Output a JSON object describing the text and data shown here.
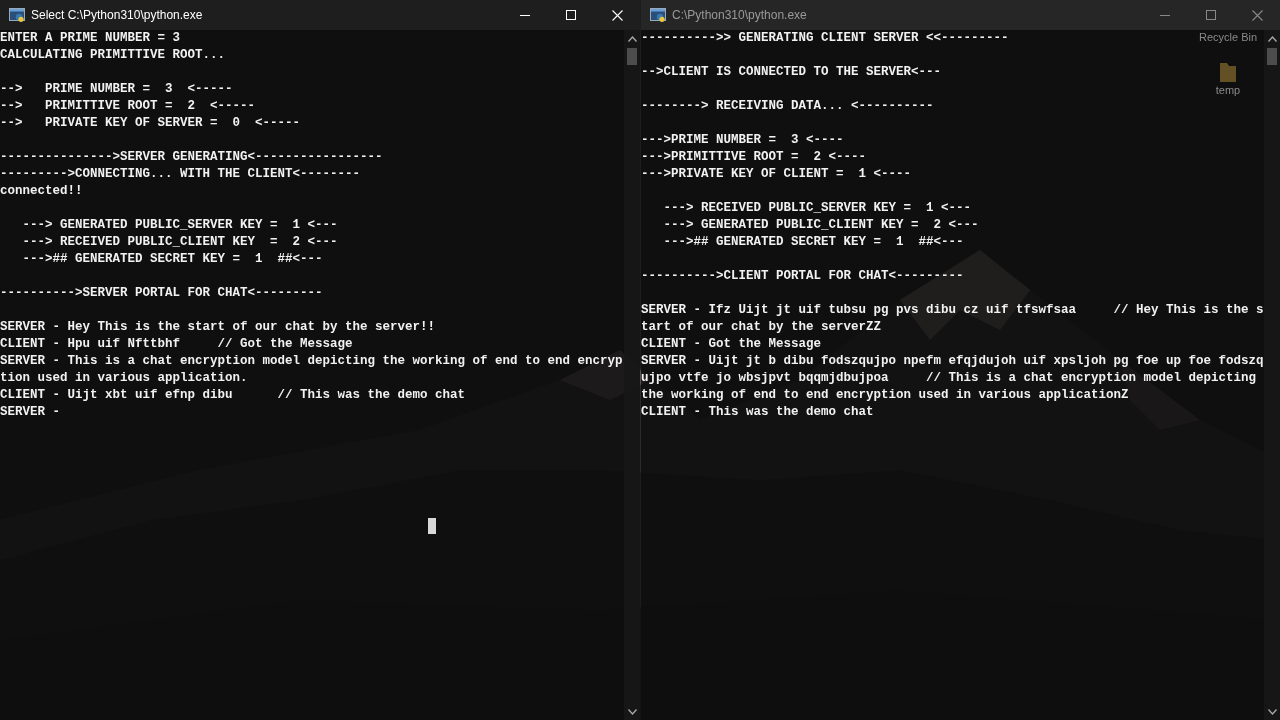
{
  "desktop": {
    "icons": [
      {
        "kind": "bin",
        "label": "Recycle Bin"
      },
      {
        "kind": "folder",
        "label": "temp"
      }
    ]
  },
  "windows": [
    {
      "title": "Select C:\\Python310\\python.exe",
      "active": true,
      "cursor": true,
      "blocks": [
        [
          "ENTER A PRIME NUMBER = 3",
          "CALCULATING PRIMITTIVE ROOT..."
        ],
        [
          "-->   PRIME NUMBER =  3  <-----",
          "-->   PRIMITTIVE ROOT =  2  <-----",
          "-->   PRIVATE KEY OF SERVER =  0  <-----"
        ],
        [
          "--------------->SERVER GENERATING<-----------------",
          "--------->CONNECTING... WITH THE CLIENT<--------",
          "connected!!"
        ],
        [
          "   ---> GENERATED PUBLIC_SERVER KEY =  1 <---",
          "   ---> RECEIVED PUBLIC_CLIENT KEY  =  2 <---",
          "   --->## GENERATED SECRET KEY =  1  ##<---"
        ],
        [
          "---------->SERVER PORTAL FOR CHAT<---------"
        ],
        [
          "SERVER - Hey This is the start of our chat by the server!!",
          "CLIENT - Hpu uif Nfttbhf     // Got the Message",
          "SERVER - This is a chat encryption model depicting the working of end to end encryp",
          "tion used in various application.",
          "CLIENT - Uijt xbt uif efnp dibu      // This was the demo chat",
          "SERVER -"
        ]
      ]
    },
    {
      "title": "C:\\Python310\\python.exe",
      "active": false,
      "blocks": [
        [
          "---------->> GENERATING CLIENT SERVER <<---------"
        ],
        [
          "-->CLIENT IS CONNECTED TO THE SERVER<---"
        ],
        [
          "--------> RECEIVING DATA... <----------"
        ],
        [
          "--->PRIME NUMBER =  3 <----",
          "--->PRIMITTIVE ROOT =  2 <----",
          "--->PRIVATE KEY OF CLIENT =  1 <----"
        ],
        [
          "   ---> RECEIVED PUBLIC_SERVER KEY =  1 <---",
          "   ---> GENERATED PUBLIC_CLIENT KEY =  2 <---",
          "   --->## GENERATED SECRET KEY =  1  ##<---"
        ],
        [
          "---------->CLIENT PORTAL FOR CHAT<---------"
        ],
        [
          "SERVER - Ifz Uijt jt uif tubsu pg pvs dibu cz uif tfswfsaa     // Hey This is the s",
          "tart of our chat by the serverZZ",
          "CLIENT - Got the Message",
          "SERVER - Uijt jt b dibu fodszqujpo npefm efqjdujoh uif xpsljoh pg foe up foe fodszq",
          "ujpo vtfe jo wbsjpvt bqqmjdbujpoa     // This is a chat encryption model depicting",
          "the working of end to end encryption used in various applicationZ",
          "CLIENT - This was the demo chat"
        ]
      ]
    }
  ]
}
